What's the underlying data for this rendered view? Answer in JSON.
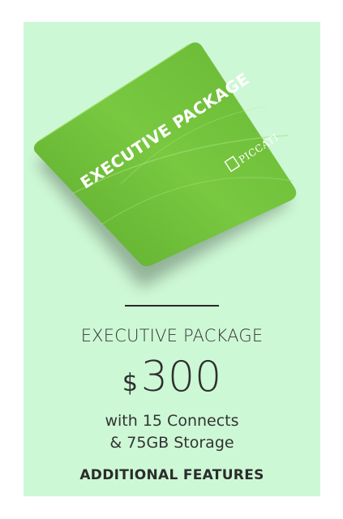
{
  "card": {
    "title": "EXECUTIVE PACKAGE",
    "brand": "PICCATI",
    "color": "#6cc03a"
  },
  "package": {
    "title": "EXECUTIVE PACKAGE",
    "currency": "$",
    "amount": "300",
    "feature_line_1": "with 15 Connects",
    "feature_line_2": "& 75GB Storage",
    "more_link": "ADDITIONAL FEATURES"
  },
  "colors": {
    "panel_bg": "#cdf8d5",
    "card_green": "#6cc03a"
  }
}
